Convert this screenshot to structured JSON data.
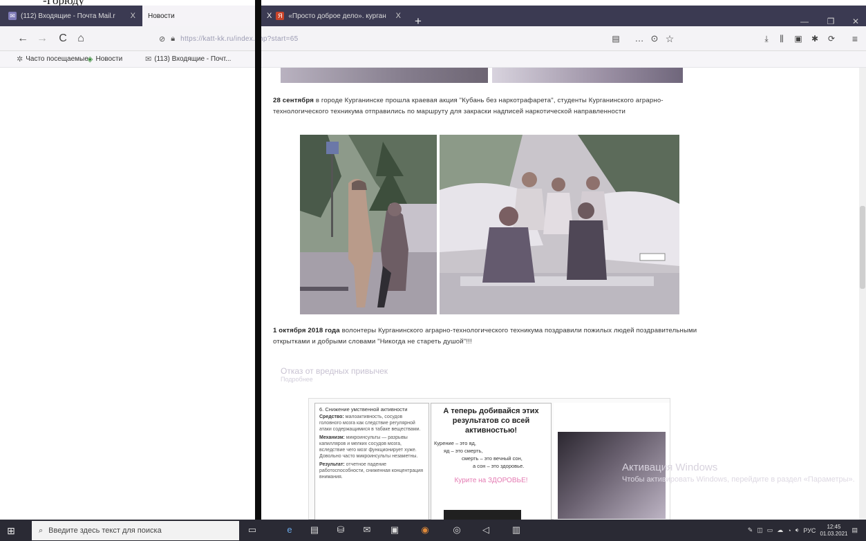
{
  "doc_fragment": "-Горюду",
  "tabs": [
    {
      "title": "(112) Входящие - Почта Mail.r",
      "active": false
    },
    {
      "title": "Новости",
      "active": true
    },
    {
      "title": "«Просто доброе дело». курган",
      "active": false
    }
  ],
  "tab_close_glyph": "X",
  "new_tab_glyph": "+",
  "nav": {
    "back_icon": "←",
    "forward_icon": "→",
    "reload_icon": "C",
    "home_icon": "⌂",
    "url_text": "https://katt-kk.ru/index.php?start=65",
    "more_icon": "…",
    "pocket_icon": "⊙",
    "star_icon": "☆"
  },
  "bookmarks": [
    {
      "label": "Часто посещаемые",
      "icon": "gear-icon"
    },
    {
      "label": "Новости",
      "icon": "rss-icon"
    },
    {
      "label": "(113) Входящие - Почт...",
      "icon": "mail-icon"
    }
  ],
  "content": {
    "para1_bold": "28 сентября",
    "para1_text": " в городе Курганинске прошла краевая акция \"Кубань без наркотрафарета\", студенты Курганинского аграрно-технологического техникума отправились по маршруту для закраски надписей наркотической направленности",
    "para2_bold": "1 октября 2018 года",
    "para2_text": " волонтеры Курганинского аграрно-технологического техникума поздравили пожилых людей поздравительными открытками и добрыми словами \"Никогда не стареть душой\"!!!",
    "muted_title": "Отказ от вредных привычек",
    "muted_sub": "Подробнее"
  },
  "poster": {
    "col1_heading": "6. Снижение умственной активности",
    "col1_items": [
      {
        "label": "Средство:",
        "text": "малоактивность, сосудов головного мозга как следствие регулярной атаки содержащимися в табаке веществами."
      },
      {
        "label": "Механизм:",
        "text": "микроинсульты — разрывы капилляров и мелких сосудов мозга, вследствие чего мозг функционирует хуже. Довольно часто микроинсульты незаметны."
      },
      {
        "label": "Результат:",
        "text": "отчетное падение работоспособности, сниженная концентрация внимания."
      }
    ],
    "col2_heading": "А теперь добивайся этих результатов со всей активностью!",
    "col2_poem": [
      "Курение – это яд,",
      "яд – это смерть,",
      "смерть – это вечный сон,",
      "а сон – это здоровье."
    ],
    "col2_pink": "Курите на ЗДОРОВЬЕ!"
  },
  "watermark": {
    "title": "Активация Windows",
    "subtitle": "Чтобы активировать Windows, перейдите в раздел «Параметры»."
  },
  "taskbar": {
    "search_placeholder": "Введите здесь текст для поиска",
    "lang": "РУС",
    "time": "12:45",
    "date": "01.03.2021"
  }
}
